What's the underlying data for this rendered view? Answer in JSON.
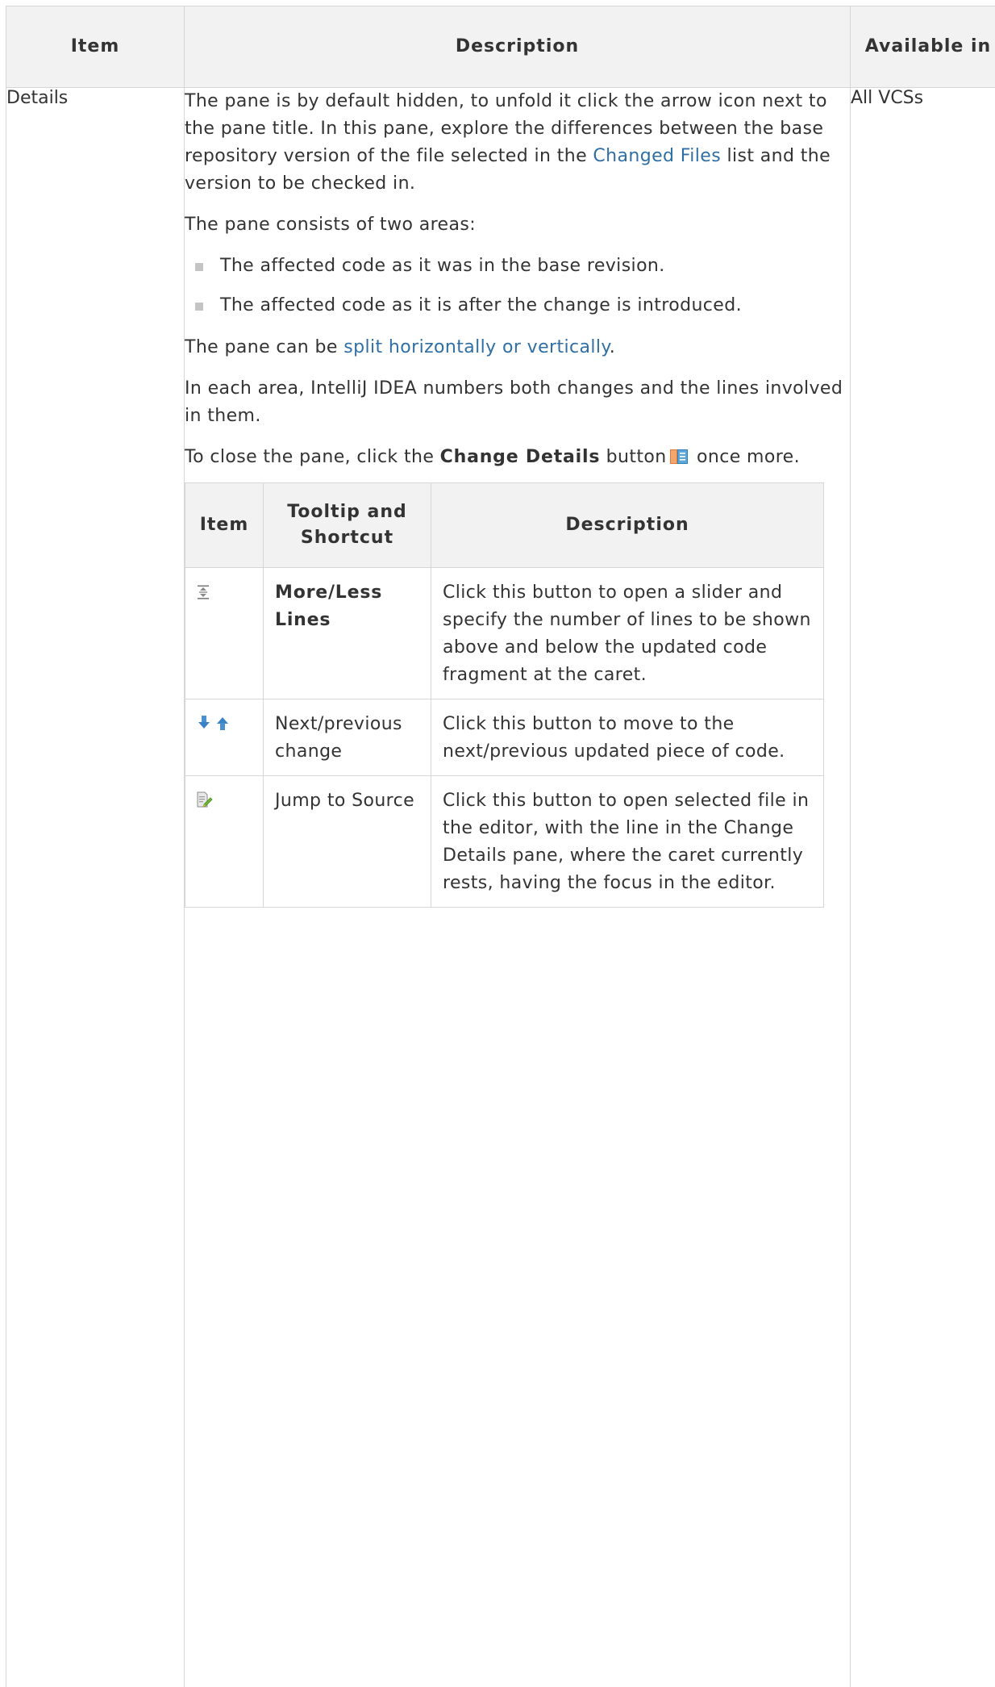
{
  "table": {
    "headers": {
      "item": "Item",
      "description": "Description",
      "available_in": "Available in"
    },
    "row": {
      "item": "Details",
      "available_in": "All VCSs",
      "para1": {
        "before": "The pane is by default hidden, to unfold it click the arrow icon next to the pane title. In this pane, explore the differences between the base repository version of the file selected in the ",
        "link": "Changed Files",
        "after": " list and the version to be checked in."
      },
      "para2": "The pane consists of two areas:",
      "areas": [
        "The affected code as it was in the base revision.",
        "The affected code as it is after the change is introduced."
      ],
      "para3": {
        "before": "The pane can be ",
        "link": "split horizontally or vertically",
        "after": "."
      },
      "para4": "In each area, IntelliJ IDEA numbers both changes and the lines involved in them.",
      "para5": {
        "before": "To close the pane, click the ",
        "bold": "Change Details",
        "mid": " button",
        "icon": "change-details-icon",
        "after": " once more."
      }
    }
  },
  "inner_table": {
    "headers": {
      "item": "Item",
      "tooltip": "Tooltip and Shortcut",
      "description": "Description"
    },
    "rows": [
      {
        "icon": "more-less-lines-icon",
        "tooltip": "More/Less Lines",
        "tooltip_bold": true,
        "description": "Click this button to open a slider and specify the number of lines to be shown above and below the updated code fragment at the caret."
      },
      {
        "icon": "next-previous-arrows-icon",
        "tooltip": "Next/previous change",
        "tooltip_bold": false,
        "description": "Click this button to move to the next/previous updated piece of code."
      },
      {
        "icon": "jump-to-source-icon",
        "tooltip": "Jump to Source",
        "tooltip_bold": false,
        "description": "Click this button to open selected file in the editor, with the line in the Change Details pane, where the caret currently rests, having the focus in the editor."
      }
    ]
  },
  "colors": {
    "link": "#2f6fa5",
    "border": "#d6d6d6",
    "header_bg": "#f2f2f2",
    "text": "#333333",
    "bullet": "#c4c4c4"
  }
}
